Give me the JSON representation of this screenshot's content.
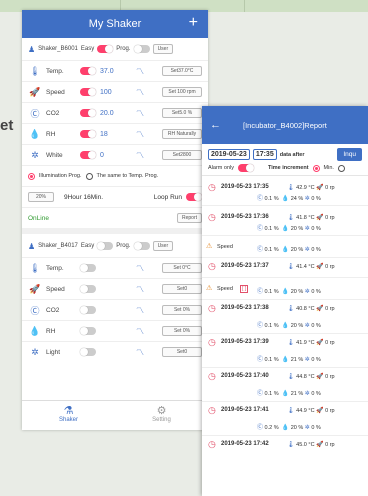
{
  "background_text": "et",
  "shaker": {
    "title": "My Shaker",
    "device1": {
      "name": "Shaker_B6001",
      "easy_label": "Easy",
      "prog_label": "Prog.",
      "user_label": "User",
      "params": [
        {
          "icon": "thermometer-icon",
          "name": "Temp.",
          "value": "37.0",
          "set": "Set37.0°C"
        },
        {
          "icon": "speed-icon",
          "name": "Speed",
          "value": "100",
          "set": "Set 100 rpm"
        },
        {
          "icon": "co2-icon",
          "name": "CO2",
          "value": "20.0",
          "set": "Set5.0 %"
        },
        {
          "icon": "humidity-icon",
          "name": "RH",
          "value": "18",
          "set": "RH Naturally"
        },
        {
          "icon": "light-icon",
          "name": "White",
          "value": "0",
          "set": "Set2800"
        }
      ],
      "illumination_prog": "Illumination Prog.",
      "same_as_temp": "The same to Temp. Prog.",
      "percent": "20%",
      "duration": "9Hour 16Min.",
      "loop_run": "Loop Run",
      "status": "OnLine",
      "report_label": "Report"
    },
    "device2": {
      "name": "Shaker_B4017",
      "easy_label": "Easy",
      "prog_label": "Prog.",
      "user_label": "User",
      "params": [
        {
          "icon": "thermometer-icon",
          "name": "Temp.",
          "set": "Set 0°C"
        },
        {
          "icon": "speed-icon",
          "name": "Speed",
          "set": "Set0"
        },
        {
          "icon": "co2-icon",
          "name": "CO2",
          "set": "Set 0%"
        },
        {
          "icon": "humidity-icon",
          "name": "RH",
          "set": "Set 0%"
        },
        {
          "icon": "light-icon",
          "name": "Light",
          "set": "Set0"
        }
      ]
    },
    "tabs": [
      {
        "label": "Shaker",
        "icon": "flask-icon",
        "active": true
      },
      {
        "label": "Setting",
        "icon": "settings-icon",
        "active": false
      }
    ]
  },
  "report": {
    "title": "[Incubator_B4002]Report",
    "date": "2019-05-23",
    "time": "17:35",
    "data_after": "data after",
    "inquire_label": "Inqu",
    "alarm_only": "Alarm only",
    "time_increment": "Time increment",
    "min_label": "Min.",
    "records": [
      {
        "type": "clock",
        "timestamp": "2019-05-23 17:35",
        "temp": "42.9 °C",
        "speed": "0 rp",
        "co2": "0.1 %",
        "rh": "24 %",
        "light": "0 %"
      },
      {
        "type": "clock",
        "timestamp": "2019-05-23 17:36",
        "temp": "41.8 °C",
        "speed": "0 rp",
        "co2": "0.1 %",
        "rh": "20 %",
        "light": "0 %"
      },
      {
        "type": "warn",
        "label": "Speed",
        "co2": "0.1 %",
        "rh": "20 %",
        "light": "0 %"
      },
      {
        "type": "clock",
        "timestamp": "2019-05-23 17:37",
        "temp": "41.4 °C",
        "speed": "0 rp"
      },
      {
        "type": "warn",
        "label": "Speed",
        "co2": "0.1 %",
        "rh": "20 %",
        "light": "0 %"
      },
      {
        "type": "clock",
        "timestamp": "2019-05-23 17:38",
        "temp": "40.8 °C",
        "speed": "0 rp",
        "co2": "0.1 %",
        "rh": "20 %",
        "light": "0 %"
      },
      {
        "type": "clock",
        "timestamp": "2019-05-23 17:39",
        "temp": "41.9 °C",
        "speed": "0 rp",
        "co2": "0.1 %",
        "rh": "21 %",
        "light": "0 %"
      },
      {
        "type": "clock",
        "timestamp": "2019-05-23 17:40",
        "temp": "44.8 °C",
        "speed": "0 rp",
        "co2": "0.1 %",
        "rh": "21 %",
        "light": "0 %"
      },
      {
        "type": "clock",
        "timestamp": "2019-05-23 17:41",
        "temp": "44.9 °C",
        "speed": "0 rp",
        "co2": "0.2 %",
        "rh": "20 %",
        "light": "0 %"
      },
      {
        "type": "clock",
        "timestamp": "2019-05-23 17:42",
        "temp": "45.0 °C",
        "speed": "0 rp"
      }
    ]
  }
}
